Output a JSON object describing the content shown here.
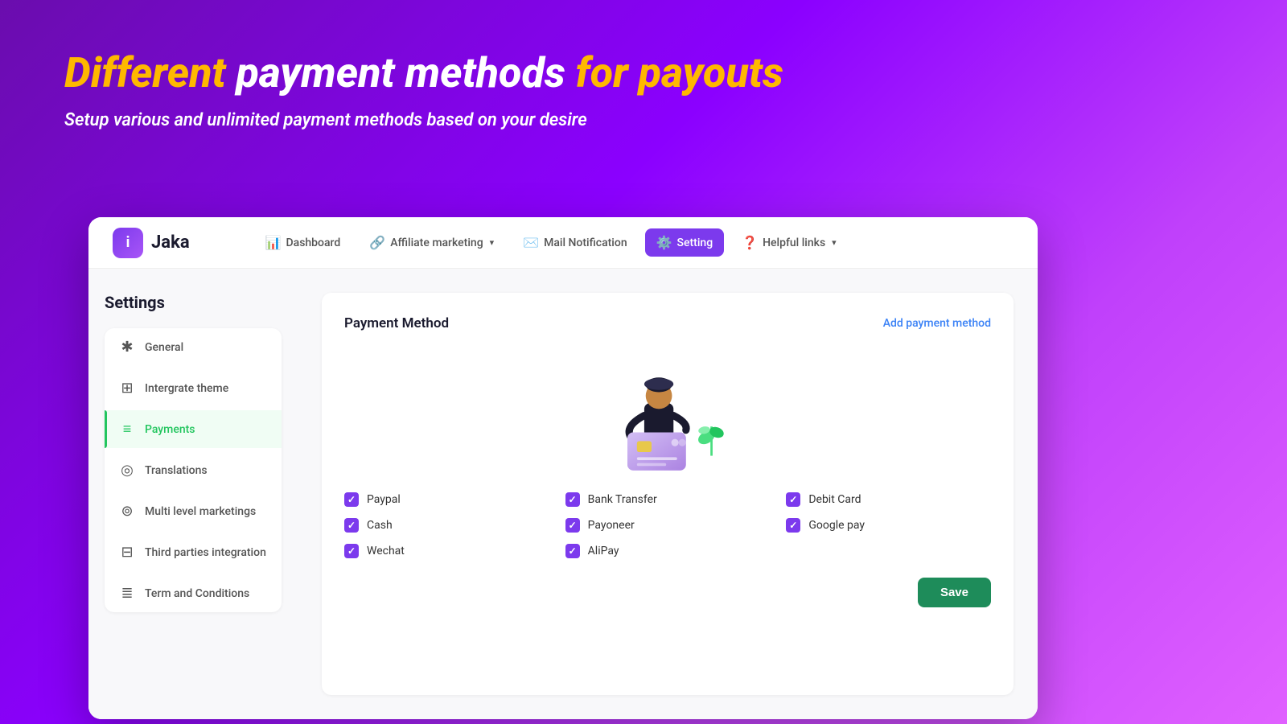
{
  "hero": {
    "title_part1": "Different",
    "title_part2": "payment methods",
    "title_part3": "for payouts",
    "subtitle": "Setup various and unlimited payment methods based on your desire"
  },
  "app": {
    "logo_letter": "i",
    "logo_name": "Jaka"
  },
  "nav": {
    "items": [
      {
        "id": "dashboard",
        "label": "Dashboard",
        "icon": "📊",
        "active": false,
        "has_chevron": false
      },
      {
        "id": "affiliate",
        "label": "Affiliate marketing",
        "icon": "🔗",
        "active": false,
        "has_chevron": true
      },
      {
        "id": "mail",
        "label": "Mail Notification",
        "icon": "✉️",
        "active": false,
        "has_chevron": false
      },
      {
        "id": "setting",
        "label": "Setting",
        "icon": "⚙️",
        "active": true,
        "has_chevron": false
      },
      {
        "id": "helpful",
        "label": "Helpful links",
        "icon": "❓",
        "active": false,
        "has_chevron": true
      }
    ]
  },
  "sidebar": {
    "title": "Settings",
    "items": [
      {
        "id": "general",
        "label": "General",
        "icon": "✱",
        "active": false
      },
      {
        "id": "integrate",
        "label": "Intergrate theme",
        "icon": "⊞",
        "active": false
      },
      {
        "id": "payments",
        "label": "Payments",
        "icon": "≡",
        "active": true
      },
      {
        "id": "translations",
        "label": "Translations",
        "icon": "◎",
        "active": false
      },
      {
        "id": "multilevel",
        "label": "Multi level marketings",
        "icon": "⊚",
        "active": false
      },
      {
        "id": "third",
        "label": "Third parties integration",
        "icon": "⊟",
        "active": false
      },
      {
        "id": "terms",
        "label": "Term and Conditions",
        "icon": "≣",
        "active": false
      }
    ]
  },
  "main_panel": {
    "title": "Payment Method",
    "add_link": "Add payment method",
    "payment_methods": [
      {
        "id": "paypal",
        "label": "Paypal",
        "checked": true
      },
      {
        "id": "bank",
        "label": "Bank Transfer",
        "checked": true
      },
      {
        "id": "debit",
        "label": "Debit Card",
        "checked": true
      },
      {
        "id": "cash",
        "label": "Cash",
        "checked": true
      },
      {
        "id": "payoneer",
        "label": "Payoneer",
        "checked": true
      },
      {
        "id": "googlepay",
        "label": "Google pay",
        "checked": true
      },
      {
        "id": "wechat",
        "label": "Wechat",
        "checked": true
      },
      {
        "id": "alipay",
        "label": "AliPay",
        "checked": true
      }
    ],
    "save_label": "Save"
  }
}
